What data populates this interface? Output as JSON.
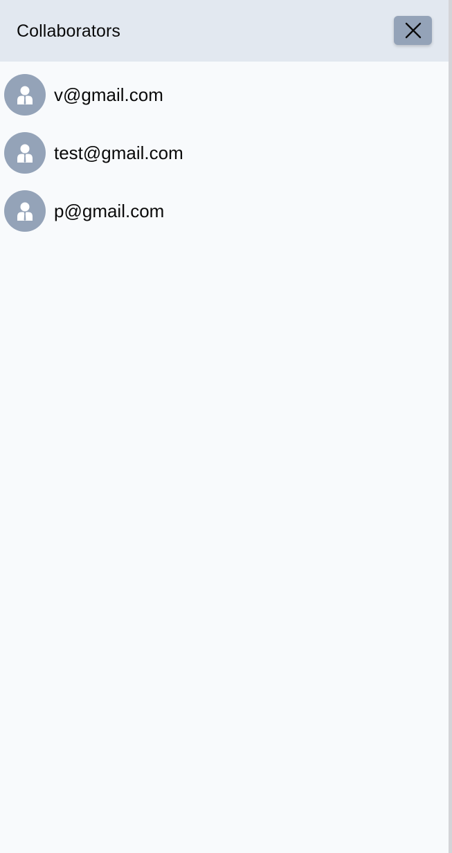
{
  "panel": {
    "title": "Collaborators",
    "close_icon": "close-icon"
  },
  "collaborators": [
    {
      "email": "v@gmail.com",
      "avatar_icon": "user-avatar-icon"
    },
    {
      "email": "test@gmail.com",
      "avatar_icon": "user-avatar-icon"
    },
    {
      "email": "p@gmail.com",
      "avatar_icon": "user-avatar-icon"
    }
  ],
  "colors": {
    "header_bg": "#e2e8f0",
    "panel_bg": "#f8fafc",
    "accent": "#94a3b8",
    "text": "#0a0a0a"
  }
}
